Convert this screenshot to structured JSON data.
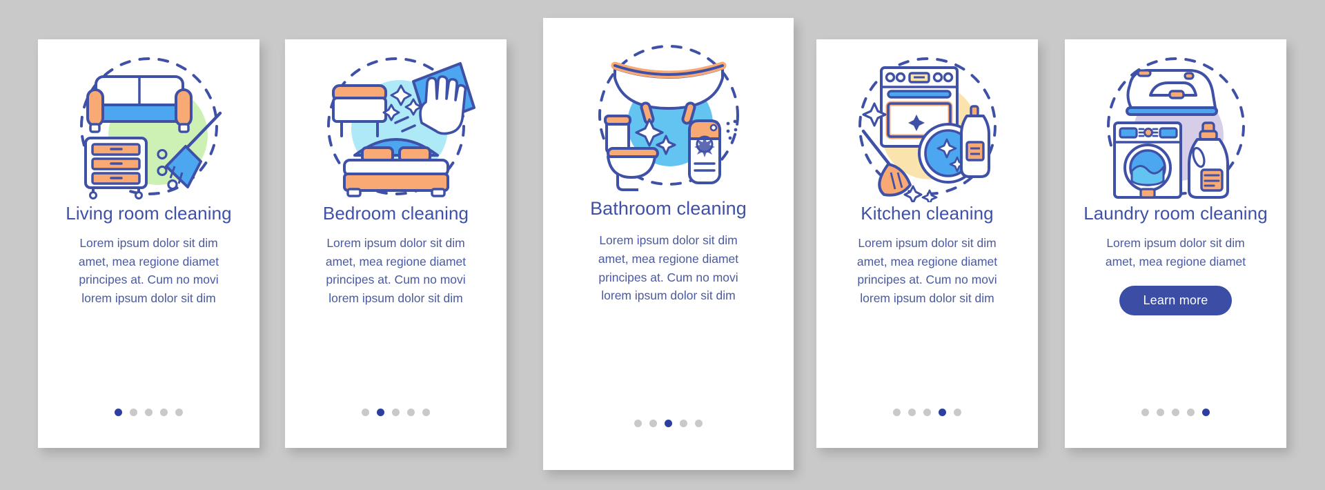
{
  "background_color": "#c9c9c9",
  "palette": {
    "card_bg": "#ffffff",
    "title": "#3f51a6",
    "body": "#4a5aa0",
    "outline": "#3f51a6",
    "accent_orange": "#f9a974",
    "accent_blue": "#4da6f0",
    "dot_active": "#2c3f9e",
    "dot_inactive": "#c9c9c9",
    "cta_bg": "#3b4da5",
    "cta_text": "#ffffff"
  },
  "pagination": {
    "total_dots": 5
  },
  "cards": [
    {
      "id": "living-room",
      "title": "Living room cleaning",
      "body": "Lorem ipsum dolor sit dim amet, mea regione diamet principes at. Cum no movi lorem ipsum dolor sit dim",
      "illustration": "sofa-dresser-broom-illustration",
      "blob_color": "#cdf0b4",
      "active_dot": 1,
      "cta": null
    },
    {
      "id": "bedroom",
      "title": "Bedroom cleaning",
      "body": "Lorem ipsum dolor sit dim amet, mea regione diamet principes at. Cum no movi lorem ipsum dolor sit dim",
      "illustration": "bed-nightstand-wiping-hand-illustration",
      "blob_color": "#aee9f7",
      "active_dot": 2,
      "cta": null
    },
    {
      "id": "bathroom",
      "title": "Bathroom cleaning",
      "body": "Lorem ipsum dolor sit dim amet, mea regione diamet principes at. Cum no movi lorem ipsum dolor sit dim",
      "illustration": "bathtub-toilet-spray-illustration",
      "blob_color": "#63c4f2",
      "active_dot": 3,
      "cta": null
    },
    {
      "id": "kitchen",
      "title": "Kitchen cleaning",
      "body": "Lorem ipsum dolor sit dim amet, mea regione diamet principes at. Cum no movi lorem ipsum dolor sit dim",
      "illustration": "stove-mop-pan-detergent-illustration",
      "blob_color": "#fbe3ad",
      "active_dot": 4,
      "cta": null
    },
    {
      "id": "laundry-room",
      "title": "Laundry room cleaning",
      "body": "Lorem ipsum dolor sit dim amet, mea regione diamet",
      "illustration": "iron-washing-machine-detergent-illustration",
      "blob_color": "#d6cde8",
      "active_dot": 5,
      "cta": "Learn more"
    }
  ]
}
